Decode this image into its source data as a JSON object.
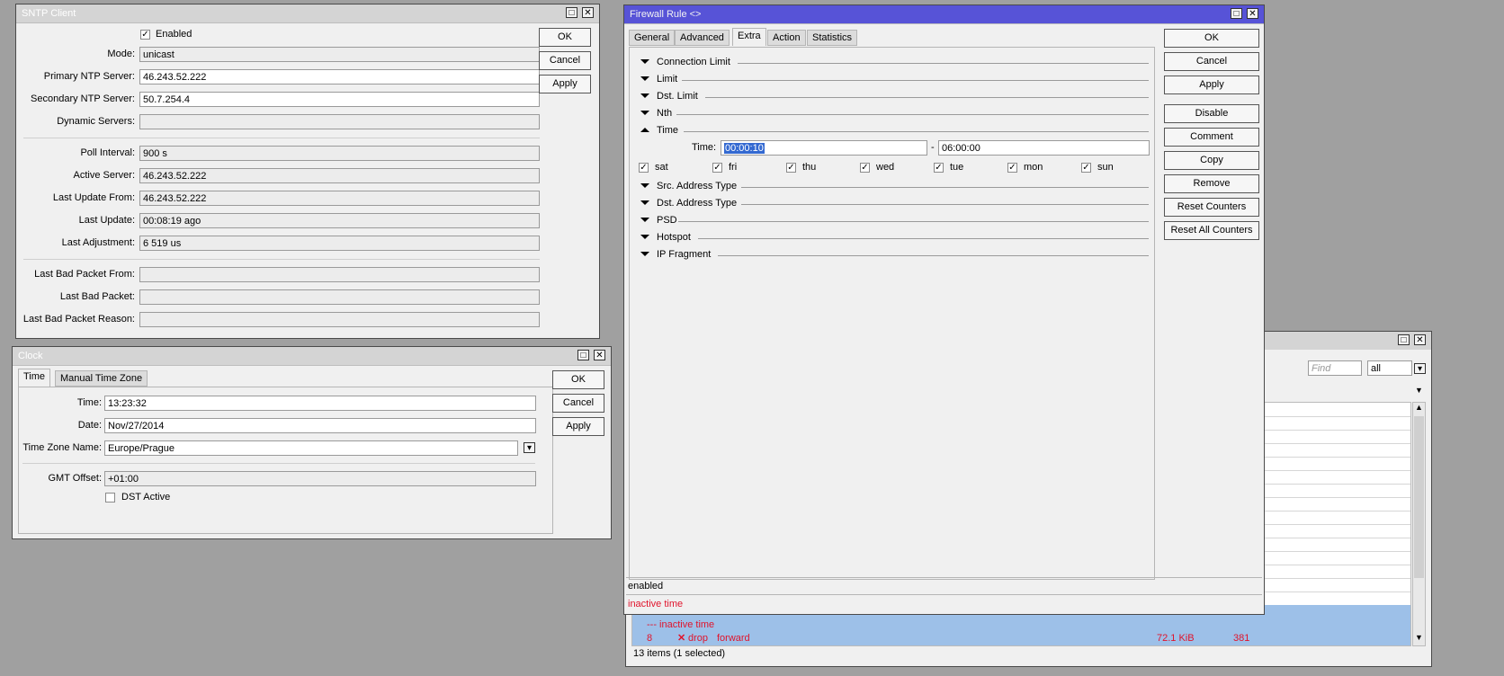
{
  "sntp": {
    "title": "SNTP Client",
    "enabled_label": "Enabled",
    "fields": [
      {
        "label": "Mode:",
        "value": "unicast"
      },
      {
        "label": "Primary NTP Server:",
        "value": "46.243.52.222"
      },
      {
        "label": "Secondary NTP Server:",
        "value": "50.7.254.4"
      },
      {
        "label": "Dynamic Servers:",
        "value": ""
      },
      {
        "label": "Poll Interval:",
        "value": "900 s"
      },
      {
        "label": "Active Server:",
        "value": "46.243.52.222"
      },
      {
        "label": "Last Update From:",
        "value": "46.243.52.222"
      },
      {
        "label": "Last Update:",
        "value": "00:08:19 ago"
      },
      {
        "label": "Last Adjustment:",
        "value": "6 519 us"
      },
      {
        "label": "Last Bad Packet From:",
        "value": ""
      },
      {
        "label": "Last Bad Packet:",
        "value": ""
      },
      {
        "label": "Last Bad Packet Reason:",
        "value": ""
      }
    ],
    "ok": "OK",
    "cancel": "Cancel",
    "apply": "Apply"
  },
  "clock": {
    "title": "Clock",
    "tabs": [
      "Time",
      "Manual Time Zone"
    ],
    "time_label": "Time:",
    "time_value": "13:23:32",
    "date_label": "Date:",
    "date_value": "Nov/27/2014",
    "tz_label": "Time Zone Name:",
    "tz_value": "Europe/Prague",
    "gmt_label": "GMT Offset:",
    "gmt_value": "+01:00",
    "dst_label": "DST Active",
    "ok": "OK",
    "cancel": "Cancel",
    "apply": "Apply"
  },
  "firewall": {
    "title": "Firewall Rule <>",
    "tabs": [
      "General",
      "Advanced",
      "Extra",
      "Action",
      "Statistics"
    ],
    "sections_top": [
      "Connection Limit",
      "Limit",
      "Dst. Limit",
      "Nth"
    ],
    "time_section": "Time",
    "time_label": "Time:",
    "time_from": "00:00:10",
    "time_dash": "-",
    "time_to": "06:00:00",
    "days": [
      "sat",
      "fri",
      "thu",
      "wed",
      "tue",
      "mon",
      "sun"
    ],
    "sections_bottom": [
      "Src. Address Type",
      "Dst. Address Type",
      "PSD",
      "Hotspot",
      "IP Fragment"
    ],
    "status_enabled": "enabled",
    "status_inactive": "inactive time",
    "buttons": [
      "OK",
      "Cancel",
      "Apply",
      "Disable",
      "Comment",
      "Copy",
      "Remove",
      "Reset Counters",
      "Reset All Counters"
    ]
  },
  "list": {
    "find_placeholder": "Find",
    "filter_value": "all",
    "comment_row": "--- inactive time",
    "row": {
      "num": "8",
      "action": "drop",
      "chain": "forward",
      "bytes": "72.1 KiB",
      "packets": "381"
    },
    "status": "13 items (1 selected)"
  },
  "colors": {
    "active_title": "#5753d7",
    "inactive_title": "#d4d4d4",
    "selected_row": "#9dc0e8",
    "red_text": "#e0142c"
  }
}
